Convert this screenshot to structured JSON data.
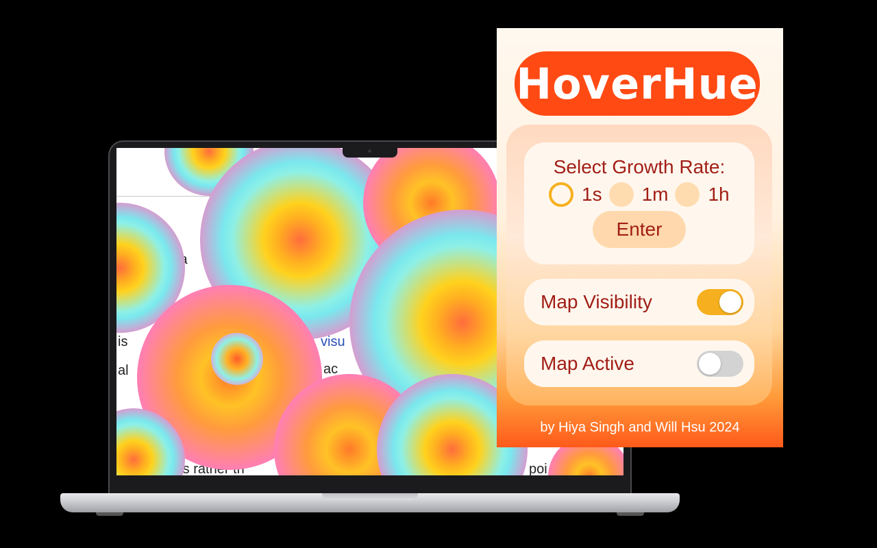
{
  "app": {
    "title": "HoverHue"
  },
  "growth_rate": {
    "label": "Select Growth Rate:",
    "options": [
      {
        "label": "1s",
        "selected": true
      },
      {
        "label": "1m",
        "selected": false
      },
      {
        "label": "1h",
        "selected": false
      }
    ],
    "enter_label": "Enter"
  },
  "toggles": {
    "map_visibility": {
      "label": "Map Visibility",
      "on": true
    },
    "map_active": {
      "label": "Map Active",
      "on": false
    }
  },
  "credit": "by Hiya Singh and Will Hsu 2024",
  "background_page": {
    "fragments": [
      "ia",
      "is",
      "al",
      "visu",
      "ac",
      "nts rather th",
      "poi"
    ]
  },
  "colors": {
    "brand_orange": "#ff4a14",
    "accent_yellow": "#f6b01f",
    "text_red": "#a11e16",
    "toggle_off": "#d3d3d3"
  }
}
